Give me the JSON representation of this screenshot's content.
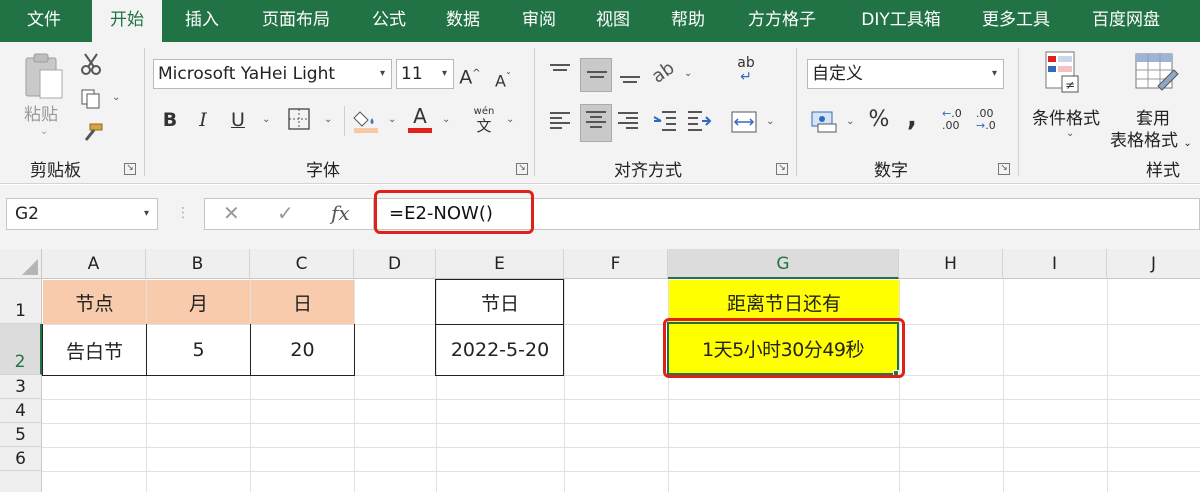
{
  "menu": {
    "tabs": [
      "文件",
      "开始",
      "插入",
      "页面布局",
      "公式",
      "数据",
      "审阅",
      "视图",
      "帮助",
      "方方格子",
      "DIY工具箱",
      "更多工具",
      "百度网盘"
    ],
    "active": "开始"
  },
  "ribbon": {
    "clipboard": {
      "label": "剪贴板",
      "paste_label": "粘贴"
    },
    "font": {
      "label": "字体",
      "font_name": "Microsoft YaHei Light",
      "font_size": "11",
      "bold": "B",
      "italic": "I",
      "underline": "U",
      "font_color_glyph": "A",
      "phonetic_top": "wén",
      "phonetic_bottom": "文",
      "grow_glyph": "A",
      "shrink_glyph": "A"
    },
    "alignment": {
      "label": "对齐方式",
      "wrap_glyph": "ab"
    },
    "number": {
      "label": "数字",
      "format": "自定义",
      "percent": "%",
      "comma": ",",
      "inc_decimal": ".00",
      "dec_decimal": ".0"
    },
    "styles": {
      "label": "样式",
      "conditional": "条件格式",
      "table_format_line1": "套用",
      "table_format_line2": "表格格式"
    }
  },
  "formula_bar": {
    "name_box": "G2",
    "cancel_glyph": "✕",
    "enter_glyph": "✓",
    "fx_glyph": "fx",
    "formula": "=E2-NOW()"
  },
  "sheet": {
    "columns": [
      "A",
      "B",
      "C",
      "D",
      "E",
      "F",
      "G",
      "H",
      "I",
      "J"
    ],
    "rows": [
      "1",
      "2",
      "3",
      "4",
      "5",
      "6"
    ],
    "selected_cell": "G2",
    "cells": {
      "A1": "节点",
      "B1": "月",
      "C1": "日",
      "E1": "节日",
      "G1": "距离节日还有",
      "A2": "告白节",
      "B2": "5",
      "C2": "20",
      "E2": "2022-5-20",
      "G2": "1天5小时30分49秒"
    },
    "colors": {
      "header_fill": "#f8cbad",
      "highlight_fill": "#ffff00",
      "annotation_border": "#e0211b",
      "theme_green": "#217346"
    }
  }
}
